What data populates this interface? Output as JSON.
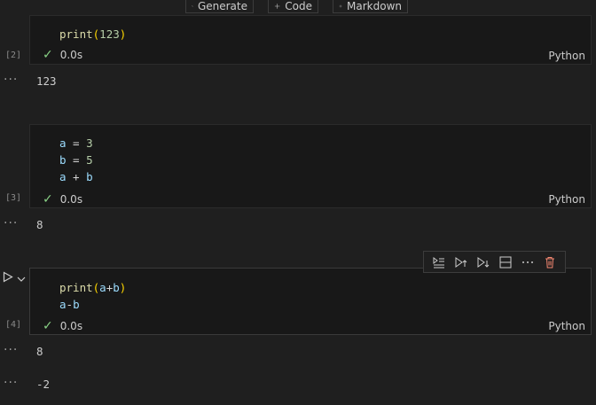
{
  "top_toolbar": {
    "generate_label": "Generate",
    "code_label": "Code",
    "markdown_label": "Markdown"
  },
  "cells": [
    {
      "exec_count": "[2]",
      "code": {
        "fn": "print",
        "arg": "123"
      },
      "status_time": "0.0s",
      "language": "Python",
      "outputs": [
        "123"
      ]
    },
    {
      "exec_count": "[3]",
      "code_lines": [
        {
          "var": "a",
          "op": " = ",
          "num": "3"
        },
        {
          "var": "b",
          "op": " = ",
          "num": "5"
        },
        {
          "left": "a",
          "op": " + ",
          "right": "b"
        }
      ],
      "status_time": "0.0s",
      "language": "Python",
      "outputs": [
        "8"
      ]
    },
    {
      "exec_count": "[4]",
      "code_lines": [
        {
          "fn": "print",
          "inner_left": "a",
          "inner_op": "+",
          "inner_right": "b"
        },
        {
          "left": "a",
          "op": "-",
          "right": "b"
        }
      ],
      "status_time": "0.0s",
      "language": "Python",
      "outputs": [
        "8",
        "-2"
      ]
    }
  ],
  "icons": {
    "run": "play-icon",
    "expand": "chevron-down-icon",
    "status": "check-icon",
    "more": "ellipsis-icon"
  },
  "colors": {
    "background": "#1f1f1f",
    "cell_background": "#181818",
    "check": "#89d185",
    "function": "#dcdcaa",
    "number": "#b5cea8",
    "variable": "#9cdcfe",
    "delete": "#f48771"
  }
}
